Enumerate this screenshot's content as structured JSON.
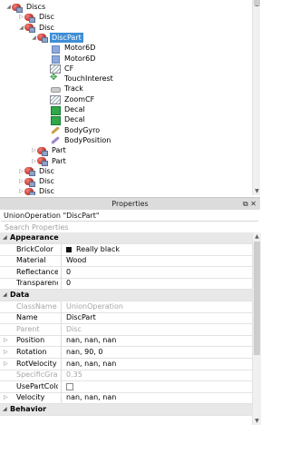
{
  "explorer": {
    "rows": [
      {
        "label": "Discs",
        "indent": 0,
        "expanded": true,
        "icon": "disc-icon"
      },
      {
        "label": "Disc",
        "indent": 1,
        "expanded": false,
        "icon": "disc-icon"
      },
      {
        "label": "Disc",
        "indent": 1,
        "expanded": true,
        "icon": "disc-icon"
      },
      {
        "label": "DiscPart",
        "indent": 2,
        "expanded": true,
        "icon": "disc-icon",
        "selected": true
      },
      {
        "label": "Motor6D",
        "indent": 3,
        "icon": "motor6d-icon"
      },
      {
        "label": "Motor6D",
        "indent": 3,
        "icon": "motor6d-icon"
      },
      {
        "label": "CF",
        "indent": 3,
        "icon": "cframe-value-icon"
      },
      {
        "label": "TouchInterest",
        "indent": 3,
        "icon": "touch-interest-icon"
      },
      {
        "label": "Track",
        "indent": 3,
        "icon": "animation-track-icon"
      },
      {
        "label": "ZoomCF",
        "indent": 3,
        "icon": "cframe-value-icon"
      },
      {
        "label": "Decal",
        "indent": 3,
        "icon": "decal-icon"
      },
      {
        "label": "Decal",
        "indent": 3,
        "icon": "decal-icon"
      },
      {
        "label": "BodyGyro",
        "indent": 3,
        "icon": "body-gyro-icon"
      },
      {
        "label": "BodyPosition",
        "indent": 3,
        "icon": "body-position-icon"
      },
      {
        "label": "Part",
        "indent": 2,
        "expanded": false,
        "icon": "disc-icon"
      },
      {
        "label": "Part",
        "indent": 2,
        "expanded": false,
        "icon": "disc-icon"
      },
      {
        "label": "Disc",
        "indent": 1,
        "expanded": false,
        "icon": "disc-icon"
      },
      {
        "label": "Disc",
        "indent": 1,
        "expanded": false,
        "icon": "disc-icon"
      },
      {
        "label": "Disc",
        "indent": 1,
        "expanded": false,
        "icon": "disc-icon"
      }
    ]
  },
  "properties": {
    "title": "Properties",
    "titlebar_buttons": "⧉ ✕",
    "selection_label": "UnionOperation \"DiscPart\"",
    "search_placeholder": "Search Properties",
    "groups": [
      {
        "name": "Appearance",
        "rows": [
          {
            "name": "BrickColor",
            "value": "Really black",
            "swatch": "#111111"
          },
          {
            "name": "Material",
            "value": "Wood"
          },
          {
            "name": "Reflectance",
            "value": "0"
          },
          {
            "name": "Transparency",
            "value": "0"
          }
        ]
      },
      {
        "name": "Data",
        "rows": [
          {
            "name": "ClassName",
            "value": "UnionOperation",
            "readonly": true
          },
          {
            "name": "Name",
            "value": "DiscPart"
          },
          {
            "name": "Parent",
            "value": "Disc",
            "readonly": true
          },
          {
            "name": "Position",
            "value": "nan, nan, nan",
            "expandable": true
          },
          {
            "name": "Rotation",
            "value": "nan, 90, 0",
            "expandable": true
          },
          {
            "name": "RotVelocity",
            "value": "nan, nan, nan",
            "expandable": true
          },
          {
            "name": "SpecificGravity",
            "value": "0.35",
            "readonly": true
          },
          {
            "name": "UsePartColor",
            "value": "",
            "checkbox": true
          },
          {
            "name": "Velocity",
            "value": "nan, nan, nan",
            "expandable": true
          }
        ]
      },
      {
        "name": "Behavior",
        "rows": []
      }
    ]
  }
}
